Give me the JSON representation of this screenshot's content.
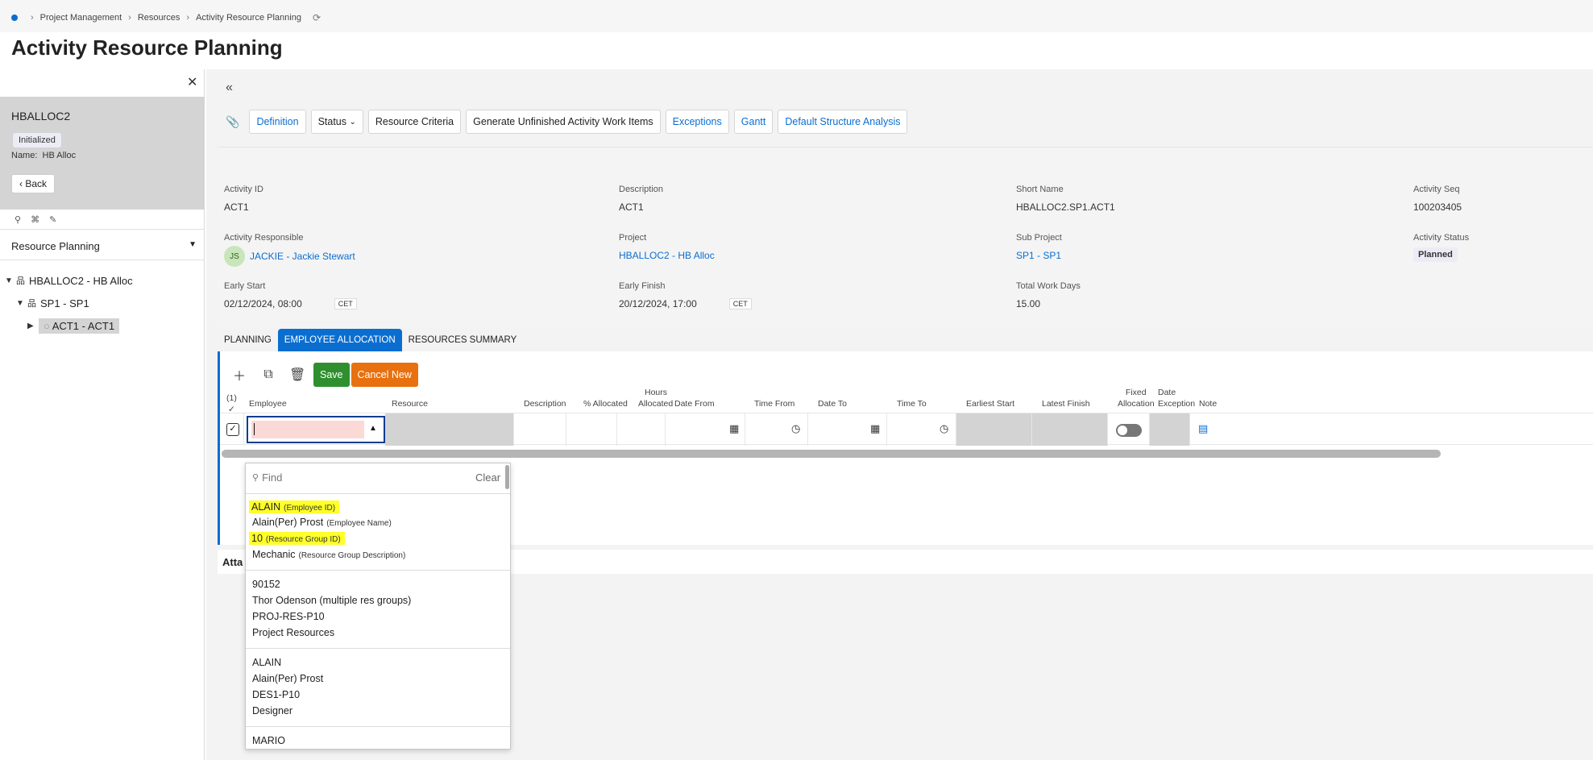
{
  "breadcrumb": [
    "Project Management",
    "Resources",
    "Activity Resource Planning"
  ],
  "page_title": "Activity Resource Planning",
  "left_panel": {
    "record_name": "HBALLOC2",
    "status": "Initialized",
    "name_label": "Name:",
    "name_value": "HB Alloc",
    "back_label": "Back",
    "view_select": "Resource Planning",
    "tree": [
      {
        "label": "HBALLOC2 - HB Alloc"
      },
      {
        "label": "SP1 - SP1"
      },
      {
        "label": "ACT1 - ACT1"
      }
    ]
  },
  "toolbar": {
    "definition": "Definition",
    "status": "Status",
    "resource_criteria": "Resource Criteria",
    "generate": "Generate Unfinished Activity Work Items",
    "exceptions": "Exceptions",
    "gantt": "Gantt",
    "default_structure": "Default Structure Analysis"
  },
  "details": {
    "activity_id": {
      "label": "Activity ID",
      "value": "ACT1"
    },
    "description": {
      "label": "Description",
      "value": "ACT1"
    },
    "short_name": {
      "label": "Short Name",
      "value": "HBALLOC2.SP1.ACT1"
    },
    "activity_seq": {
      "label": "Activity Seq",
      "value": "100203405"
    },
    "responsible": {
      "label": "Activity Responsible",
      "initials": "JS",
      "value": "JACKIE - Jackie Stewart"
    },
    "project": {
      "label": "Project",
      "value": "HBALLOC2 - HB Alloc"
    },
    "sub_project": {
      "label": "Sub Project",
      "value": "SP1 - SP1"
    },
    "activity_status": {
      "label": "Activity Status",
      "value": "Planned"
    },
    "early_start": {
      "label": "Early Start",
      "value": "02/12/2024, 08:00",
      "tz": "CET"
    },
    "early_finish": {
      "label": "Early Finish",
      "value": "20/12/2024, 17:00",
      "tz": "CET"
    },
    "total_work_days": {
      "label": "Total Work Days",
      "value": "15.00"
    }
  },
  "tabs": [
    "PLANNING",
    "EMPLOYEE ALLOCATION",
    "RESOURCES SUMMARY"
  ],
  "grid": {
    "save": "Save",
    "cancel_new": "Cancel New",
    "selected_count": "(1)",
    "columns": {
      "employee": "Employee",
      "resource": "Resource",
      "description": "Description",
      "allocated": "% Allocated",
      "hours_1": "Hours",
      "hours_2": "Allocated",
      "date_from": "Date From",
      "time_from": "Time From",
      "date_to": "Date To",
      "time_to": "Time To",
      "earliest_start": "Earliest Start",
      "latest_finish": "Latest Finish",
      "fixed_1": "Fixed",
      "fixed_2": "Allocation",
      "date_exc_1": "Date",
      "date_exc_2": "Exception",
      "note": "Note"
    }
  },
  "attachments_partial": "Atta",
  "dropdown": {
    "find_placeholder": "Find",
    "clear": "Clear",
    "group1": [
      {
        "text": "ALAIN",
        "sub": "(Employee ID)",
        "highlight": true
      },
      {
        "text": "Alain(Per) Prost",
        "sub": "(Employee Name)",
        "highlight": false
      },
      {
        "text": "10",
        "sub": "(Resource Group ID)",
        "highlight": true
      },
      {
        "text": "Mechanic",
        "sub": "(Resource Group Description)",
        "highlight": false
      }
    ],
    "group2": [
      "90152",
      "Thor Odenson (multiple res groups)",
      "PROJ-RES-P10",
      "Project Resources"
    ],
    "group3": [
      "ALAIN",
      "Alain(Per) Prost",
      "DES1-P10",
      "Designer"
    ],
    "group4": [
      "MARIO"
    ]
  }
}
